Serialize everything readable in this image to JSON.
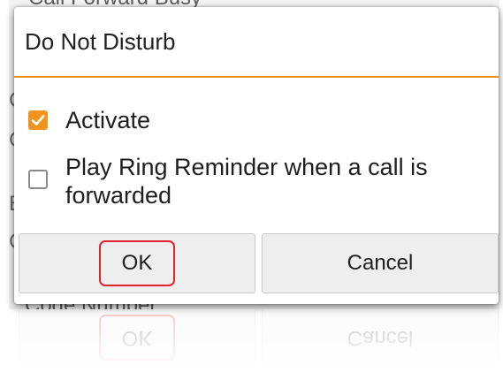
{
  "background": {
    "top_text": "Call Forward Busy",
    "bottom_text": "Code Number",
    "left_letters": [
      "C",
      "C",
      "E",
      "C"
    ]
  },
  "dialog": {
    "title": "Do Not Disturb",
    "accent_color": "#f0931f",
    "options": [
      {
        "label": "Activate",
        "checked": true
      },
      {
        "label": "Play Ring Reminder when a call is forwarded",
        "checked": false
      }
    ],
    "buttons": {
      "ok_label": "OK",
      "cancel_label": "Cancel"
    },
    "highlight_color": "#e0242f"
  },
  "icons": {
    "checked": "checkmark-icon",
    "unchecked": "empty-checkbox-icon"
  }
}
